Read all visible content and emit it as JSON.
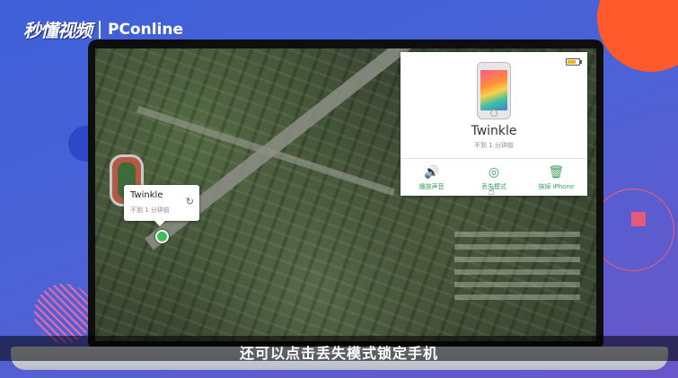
{
  "brand": {
    "left": "秒懂视频",
    "right": "PConline"
  },
  "popup": {
    "device_name": "Twinkle",
    "time": "不到 1 分钟前",
    "refresh_icon": "refresh-icon"
  },
  "panel": {
    "device_name": "Twinkle",
    "time": "不到 1 分钟前",
    "actions": [
      {
        "label": "播放声音",
        "icon": "speaker-icon"
      },
      {
        "label": "丢失模式",
        "icon": "lost-mode-icon"
      },
      {
        "label": "抹掉 iPhone",
        "icon": "trash-icon"
      }
    ],
    "battery_color": "#f2b21b"
  },
  "subtitle": "还可以点击丢失模式锁定手机",
  "colors": {
    "accent_green": "#3aa35a",
    "location_dot": "#3cc05a",
    "background": "#4a63d6"
  }
}
